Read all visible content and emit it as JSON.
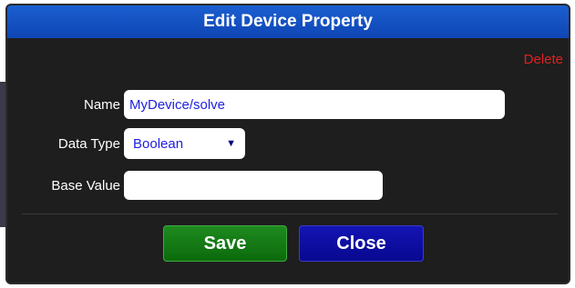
{
  "dialog": {
    "title": "Edit Device Property",
    "delete_label": "Delete"
  },
  "form": {
    "name": {
      "label": "Name",
      "value": "MyDevice/solve"
    },
    "data_type": {
      "label": "Data Type",
      "selected": "Boolean"
    },
    "base_value": {
      "label": "Base Value",
      "value": ""
    }
  },
  "buttons": {
    "save_label": "Save",
    "close_label": "Close"
  },
  "colors": {
    "title_bar": "#1a5fd0",
    "delete": "#e02020",
    "save": "#1e8a1e",
    "close": "#1414b4",
    "input_text": "#2020e0"
  },
  "icons": {
    "dropdown": "chevron-down-icon"
  }
}
